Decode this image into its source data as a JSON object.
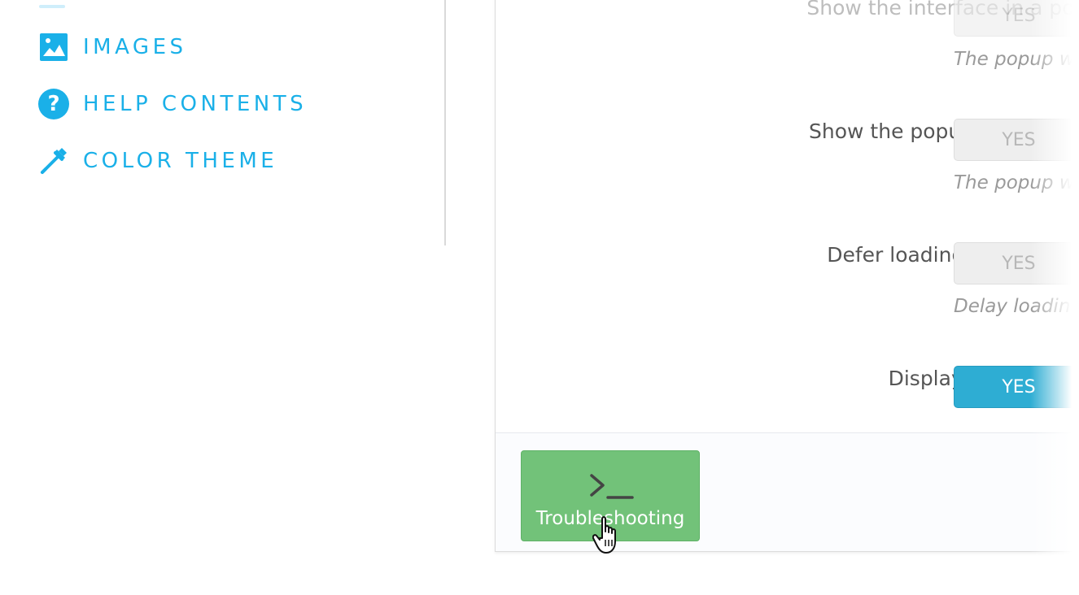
{
  "nav": {
    "items": [
      {
        "label": "IMAGES",
        "icon": "image-icon"
      },
      {
        "label": "HELP CONTENTS",
        "icon": "question-circle-icon"
      },
      {
        "label": "COLOR THEME",
        "icon": "eyedropper-icon"
      }
    ],
    "accent_color": "#1ab0e8"
  },
  "settings": {
    "rows": [
      {
        "label": "Show the interface in a popup",
        "toggle": "YES",
        "state": "off",
        "help": "The popup wi"
      },
      {
        "label": "Show the popup on page load",
        "toggle": "YES",
        "state": "off",
        "help": "The popup wi"
      },
      {
        "label": "Defer loading of the module",
        "toggle": "YES",
        "state": "off",
        "help": "Delay loading"
      },
      {
        "label": "Display the total price",
        "toggle": "YES",
        "state": "on"
      }
    ],
    "toggle_on_color": "#2eadd3"
  },
  "footer": {
    "troubleshoot_label": "Troubleshooting",
    "troubleshoot_icon": "terminal-icon",
    "button_color": "#72c279"
  }
}
